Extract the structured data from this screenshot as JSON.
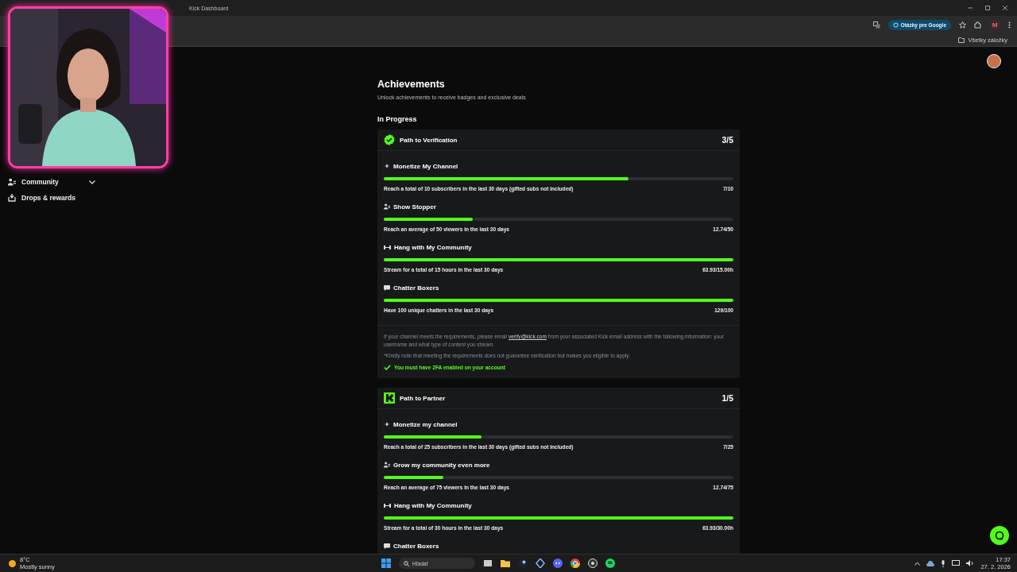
{
  "browser": {
    "tab_title": "Kick Dashboard",
    "google_button": "Otázky pre Google",
    "profile_initial": "M",
    "bookmarks_label": "Všetky záložky"
  },
  "sidebar": {
    "items": [
      {
        "kind": "group",
        "label": "Community"
      },
      {
        "kind": "link",
        "label": "Drops & rewards"
      }
    ]
  },
  "page": {
    "title": "Achievements",
    "subtitle": "Unlock achievements to receive badges and exclusive deals",
    "section": "In Progress"
  },
  "cards": [
    {
      "title": "Path to Verification",
      "count": "3/5",
      "items": [
        {
          "name": "Monetize My Channel",
          "level": 0.7,
          "requirement": "Reach a total of 10 subscribers in the last 30 days (gifted subs not included)",
          "progress": "7/10"
        },
        {
          "name": "Show Stopper",
          "level": 0.255,
          "requirement": "Reach an average of 50 viewers in the last 30 days",
          "progress": "12.74/50"
        },
        {
          "name": "Hang with My Community",
          "level": 1,
          "requirement": "Stream for a total of 15 hours in the last 30 days",
          "progress": "63.93/15.00h"
        },
        {
          "name": "Chatter Boxers",
          "level": 1,
          "requirement": "Have 100 unique chatters in the last 30 days",
          "progress": "129/100"
        }
      ],
      "note": {
        "before": "If your channel meets the requirements, please email",
        "link": "verify@kick.com",
        "after": "from your associated Kick email address with the following information: your username and what type of content you stream.",
        "disclaimer": "*Kindly note that meeting the requirements does not guarantee verification but makes you eligible to apply.",
        "check": "You must have 2FA enabled on your account"
      }
    },
    {
      "title": "Path to Partner",
      "count": "1/5",
      "items": [
        {
          "name": "Monetize my channel",
          "level": 0.28,
          "requirement": "Reach a total of 25 subscribers in the last 30 days (gifted subs not included)",
          "progress": "7/25"
        },
        {
          "name": "Grow my community even more",
          "level": 0.17,
          "requirement": "Reach an average of 75 viewers in the last 30 days",
          "progress": "12.74/75"
        },
        {
          "name": "Hang with My Community",
          "level": 1,
          "requirement": "Stream for a total of 30 hours in the last 30 days",
          "progress": "63.93/30.00h"
        },
        {
          "name": "Chatter Boxers"
        }
      ]
    }
  ],
  "taskbar": {
    "temperature": "8°C",
    "weather": "Mostly sunny",
    "search_placeholder": "Hľadať",
    "time": "17:37",
    "date": "27. 2. 2026"
  }
}
